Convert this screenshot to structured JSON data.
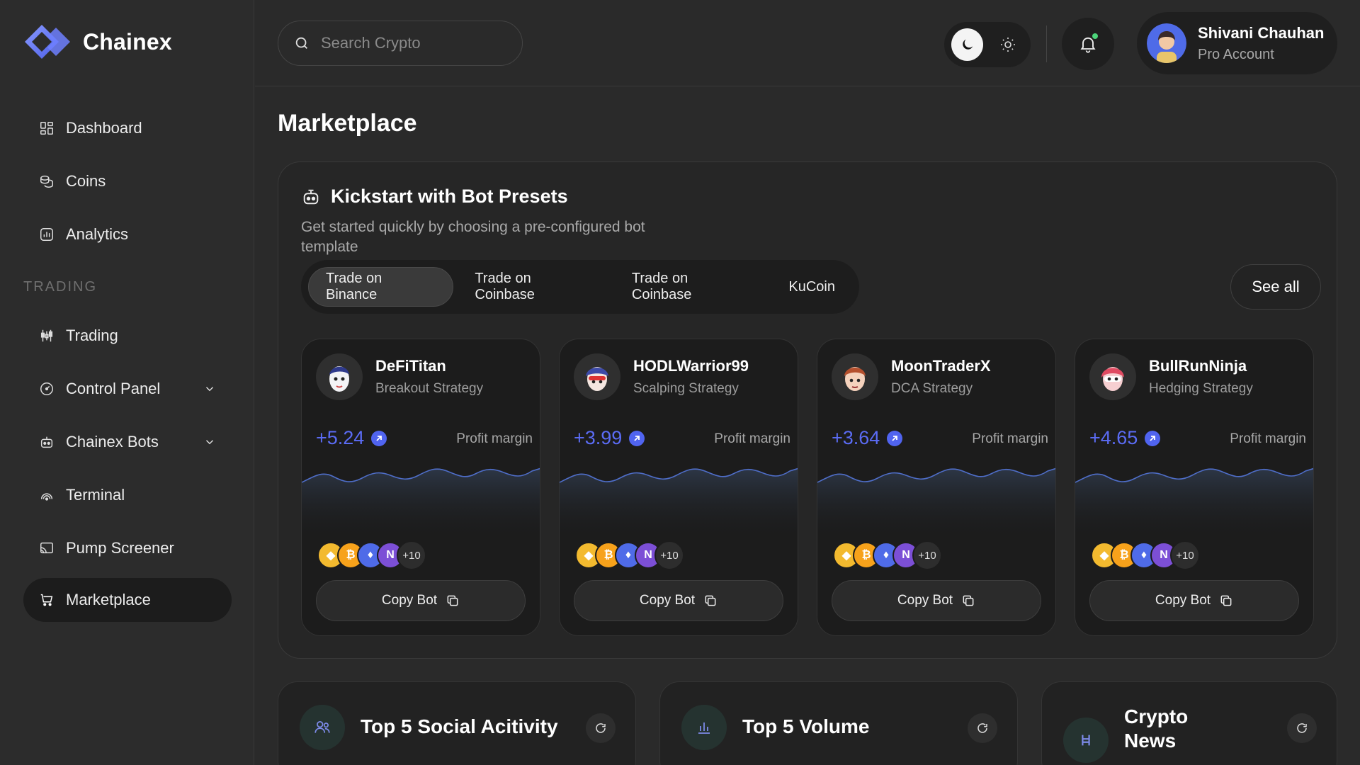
{
  "app": {
    "name": "Chainex"
  },
  "sidebar": {
    "items": [
      {
        "label": "Dashboard",
        "icon": "dashboard-icon"
      },
      {
        "label": "Coins",
        "icon": "coins-icon"
      },
      {
        "label": "Analytics",
        "icon": "analytics-icon"
      }
    ],
    "section_label": "TRADING",
    "trading_items": [
      {
        "label": "Trading",
        "icon": "candles-icon"
      },
      {
        "label": "Control Panel",
        "icon": "gauge-icon",
        "expandable": true
      },
      {
        "label": "Chainex Bots",
        "icon": "bot-icon",
        "expandable": true
      },
      {
        "label": "Terminal",
        "icon": "terminal-icon"
      },
      {
        "label": "Pump Screener",
        "icon": "screener-icon"
      },
      {
        "label": "Marketplace",
        "icon": "cart-icon",
        "active": true
      }
    ]
  },
  "header": {
    "search_placeholder": "Search Crypto",
    "theme": "dark",
    "user": {
      "name": "Shivani Chauhan",
      "role": "Pro Account"
    }
  },
  "main": {
    "title": "Marketplace",
    "presets": {
      "title": "Kickstart with Bot Presets",
      "subtitle": "Get started quickly by choosing a pre-configured bot template",
      "tabs": [
        "Trade on Binance",
        "Trade on Coinbase",
        "Trade on Coinbase",
        "KuCoin"
      ],
      "active_tab": 0,
      "see_all": "See all",
      "bots": [
        {
          "name": "DeFiTitan",
          "strategy": "Breakout Strategy",
          "value": "+5.24",
          "profit_label": "Profit margin",
          "more_coins": "+10",
          "copy_label": "Copy Bot"
        },
        {
          "name": "HODLWarrior99",
          "strategy": "Scalping Strategy",
          "value": "+3.99",
          "profit_label": "Profit margin",
          "more_coins": "+10",
          "copy_label": "Copy Bot"
        },
        {
          "name": "MoonTraderX",
          "strategy": "DCA Strategy",
          "value": "+3.64",
          "profit_label": "Profit margin",
          "more_coins": "+10",
          "copy_label": "Copy Bot"
        },
        {
          "name": "BullRunNinja",
          "strategy": "Hedging Strategy",
          "value": "+4.65",
          "profit_label": "Profit margin",
          "more_coins": "+10",
          "copy_label": "Copy Bot"
        }
      ]
    },
    "bottom_cards": [
      {
        "title": "Top 5 Social Acitivity",
        "icon": "users-icon"
      },
      {
        "title": "Top 5 Volume",
        "icon": "bar-chart-icon"
      },
      {
        "title": "Crypto News",
        "icon": "hedera-icon"
      }
    ]
  },
  "colors": {
    "accent": "#5b6cf5",
    "background": "#2a2a2a",
    "card": "#1c1c1c"
  }
}
